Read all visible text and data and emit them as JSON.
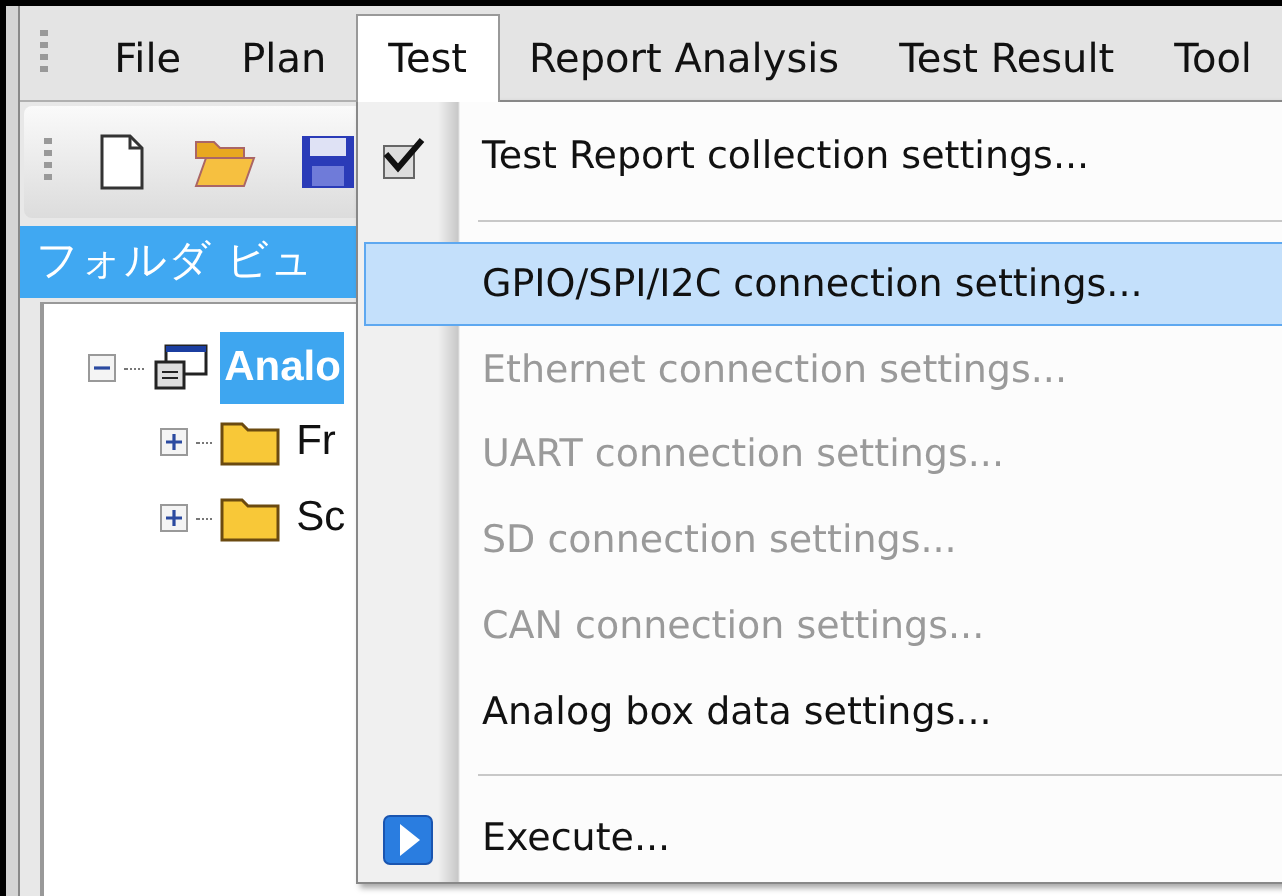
{
  "menu_bar": {
    "items": [
      {
        "label": "File",
        "selected": false
      },
      {
        "label": "Plan",
        "selected": false
      },
      {
        "label": "Test",
        "selected": true
      },
      {
        "label": "Report Analysis",
        "selected": false
      },
      {
        "label": "Test Result",
        "selected": false
      },
      {
        "label": "Tool",
        "selected": false
      }
    ]
  },
  "folder_view": {
    "title": "フォルダ ビュ",
    "tree": [
      {
        "label": "Analo",
        "selected": true,
        "expanded": true,
        "children": [
          {
            "label": "Fr",
            "selected": false,
            "expanded": false
          },
          {
            "label": "Sc",
            "selected": false,
            "expanded": false
          }
        ]
      }
    ]
  },
  "open_menu": {
    "items": [
      {
        "kind": "item",
        "label": "Test Report collection settings...",
        "checked": true,
        "disabled": false,
        "highlighted": false
      },
      {
        "kind": "separator"
      },
      {
        "kind": "item",
        "label": "GPIO/SPI/I2C connection settings...",
        "checked": false,
        "disabled": false,
        "highlighted": true
      },
      {
        "kind": "item",
        "label": "Ethernet connection settings...",
        "checked": false,
        "disabled": true,
        "highlighted": false
      },
      {
        "kind": "item",
        "label": "UART connection settings...",
        "checked": false,
        "disabled": true,
        "highlighted": false
      },
      {
        "kind": "item",
        "label": "SD connection settings...",
        "checked": false,
        "disabled": true,
        "highlighted": false
      },
      {
        "kind": "item",
        "label": "CAN connection settings...",
        "checked": false,
        "disabled": true,
        "highlighted": false
      },
      {
        "kind": "item",
        "label": "Analog box data settings...",
        "checked": false,
        "disabled": false,
        "highlighted": false
      },
      {
        "kind": "separator"
      },
      {
        "kind": "action",
        "label": "Execute...",
        "checked": false,
        "disabled": false,
        "highlighted": false
      }
    ]
  }
}
